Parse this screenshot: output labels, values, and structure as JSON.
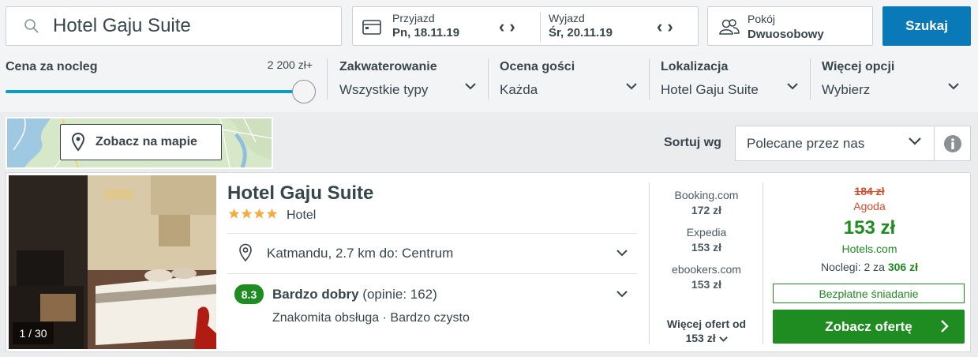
{
  "search": {
    "query": "Hotel Gaju Suite",
    "icon": "search-icon"
  },
  "dates": {
    "checkin_label": "Przyjazd",
    "checkin_value": "Pn, 18.11.19",
    "checkout_label": "Wyjazd",
    "checkout_value": "Śr, 20.11.19"
  },
  "rooms": {
    "label": "Pokój",
    "value": "Dwuosobowy"
  },
  "search_button": "Szukaj",
  "filters": {
    "price": {
      "title": "Cena za nocleg",
      "max": "2 200 zł+",
      "level": 1.0
    },
    "accommodation": {
      "title": "Zakwaterowanie",
      "value": "Wszystkie typy"
    },
    "rating": {
      "title": "Ocena gości",
      "value": "Każda"
    },
    "location": {
      "title": "Lokalizacja",
      "value": "Hotel Gaju Suite"
    },
    "more": {
      "title": "Więcej opcji",
      "value": "Wybierz"
    }
  },
  "map": {
    "button": "Zobacz na mapie"
  },
  "sort": {
    "label": "Sortuj wg",
    "value": "Polecane przez nas"
  },
  "hotel": {
    "photo_counter": "1 / 30",
    "name": "Hotel Gaju Suite",
    "stars": 4,
    "type": "Hotel",
    "location": "Katmandu, 2.7 km do: Centrum",
    "rating_score": "8.3",
    "rating_label": "Bardzo dobry",
    "rating_count": "(opinie: 162)",
    "rating_highlights": "Znakomita obsługa · Bardzo czysto",
    "offers": [
      {
        "provider": "Booking.com",
        "price": "172 zł"
      },
      {
        "provider": "Expedia",
        "price": "153 zł"
      },
      {
        "provider": "ebookers.com",
        "price": "153 zł"
      }
    ],
    "more_offers_label": "Więcej ofert od",
    "more_offers_price": "153 zł",
    "old_price": "184 zł",
    "old_price_source": "Agoda",
    "best_price": "153 zł",
    "best_price_source": "Hotels.com",
    "nights_label": "Noclegi: 2 za",
    "nights_total": "306 zł",
    "badge": "Bezpłatne śniadanie",
    "cta": "Zobacz ofertę"
  },
  "colors": {
    "accent": "#0a79b8",
    "green": "#1e8c21",
    "red": "#d84a28",
    "star": "#f6ab3f"
  }
}
